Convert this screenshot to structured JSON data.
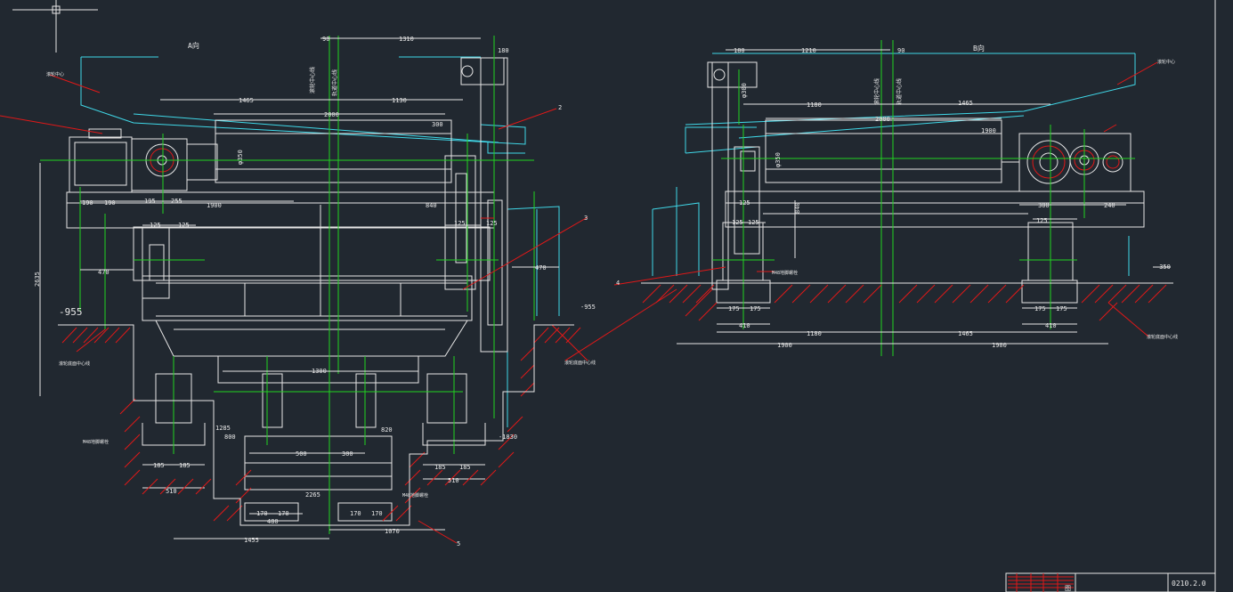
{
  "views": {
    "a_view_title": "A向",
    "b_view_title": "B向"
  },
  "a_view": {
    "dims": {
      "d90": "90",
      "d1310": "1310",
      "d180": "180",
      "d1465": "1465",
      "d1130": "1130",
      "d2000": "2000",
      "d300": "300",
      "phi350": "φ350",
      "d190": "190",
      "d190b": "190",
      "d195": "195",
      "d255": "255",
      "d1900": "1900",
      "d840": "840",
      "d125a": "125",
      "d125b": "125",
      "d125c": "125",
      "d125d": "125",
      "d470a": "470",
      "d470b": "470",
      "d2635": "2635",
      "d1300": "1300",
      "d1285": "1285",
      "d800": "800",
      "d820": "820",
      "d500a": "500",
      "d300b": "300",
      "d185a": "185",
      "d185b": "185",
      "d185c": "185",
      "d185d": "185",
      "d510a": "510",
      "d510b": "510",
      "d170a": "170",
      "d170b": "170",
      "d170c": "170",
      "d170d": "170",
      "d480": "480",
      "d2265": "2265",
      "d1455": "1455",
      "d1070": "1070"
    },
    "levels": {
      "l955a": "-955",
      "l955b": "-955",
      "l1830": "-1830"
    },
    "leaders": {
      "n2": "2",
      "n3": "3",
      "n5": "5"
    },
    "notes": {
      "mark_left_top": "滚轮中心",
      "center_line_1": "滚轮中心线",
      "center_line_2": "轨道中心线",
      "rail_note_left": "滚轮底面中心线",
      "bolt_note_1": "M48地脚螺栓",
      "bolt_note_2": "M48地脚螺栓",
      "rail_note_right": "滚轮底面中心线"
    }
  },
  "b_view": {
    "dims": {
      "d180": "180",
      "d1210": "1210",
      "d90": "90",
      "phi300": "φ300",
      "d1180": "1180",
      "d1465": "1465",
      "d2000": "2000",
      "d1900": "1900",
      "phi350": "φ350",
      "d125a": "125",
      "d125b": "125",
      "d125c": "125",
      "d125d": "125",
      "d840": "840",
      "d300": "300",
      "d240": "240",
      "d175a": "175",
      "d175b": "175",
      "d175c": "175",
      "d175d": "175",
      "d410a": "410",
      "d410b": "410",
      "d1180b": "1180",
      "d1465b": "1465",
      "d1900b": "1900",
      "d1900c": "1900"
    },
    "levels": {
      "l350": "-350"
    },
    "leaders": {
      "n4": "4"
    },
    "notes": {
      "mark_right_top": "滚轮中心",
      "center_line_1": "滚轮中心线",
      "center_line_2": "轨道中心线",
      "bolt_note": "M48地脚螺栓",
      "rail_note": "滚轮底面中心线"
    }
  },
  "title_block": {
    "drawing_no": "0210.2.0",
    "cell_label": "图"
  },
  "colors": {
    "background": "#212830",
    "outline": "#e6e6e6",
    "cyan": "#40d8e8",
    "green": "#21d321",
    "red": "#e01818"
  }
}
